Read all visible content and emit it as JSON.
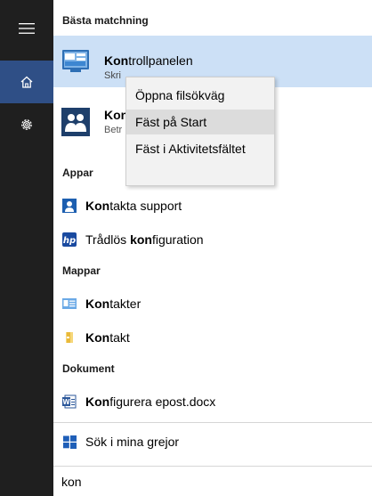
{
  "rail": {
    "menu_icon": "hamburger-icon",
    "home_icon": "home-icon",
    "settings_icon": "gear-icon",
    "accent": "#2f4f86"
  },
  "sections": {
    "best_match": "Bästa matchning",
    "apps": "Appar",
    "folders": "Mappar",
    "documents": "Dokument"
  },
  "best_match": {
    "title_bold": "Kon",
    "title_rest": "trollpanelen",
    "subtitle_visible": "Skri",
    "icon": "control-panel-icon"
  },
  "second_match": {
    "title_bold": "Kon",
    "subtitle_visible": "Betr",
    "icon": "people-icon"
  },
  "context_menu": {
    "items": [
      {
        "label": "Öppna filsökväg"
      },
      {
        "label": "Fäst på Start"
      },
      {
        "label": "Fäst i Aktivitetsfältet"
      }
    ],
    "hovered_index": 1
  },
  "apps": [
    {
      "bold": "Kon",
      "rest": "takta support",
      "icon": "contact-support-icon"
    },
    {
      "prefix": "Trådlös ",
      "bold": "kon",
      "rest": "figuration",
      "icon": "hp-wireless-icon"
    }
  ],
  "folders": [
    {
      "bold": "Kon",
      "rest": "takter",
      "icon": "contacts-folder-icon"
    },
    {
      "bold": "Kon",
      "rest": "takt",
      "icon": "folder-icon"
    }
  ],
  "documents": [
    {
      "bold": "Kon",
      "rest": "figurera epost.docx",
      "icon": "word-document-icon"
    }
  ],
  "search_my_stuff": {
    "label": "Sök i mina grejor",
    "icon": "windows-logo-icon"
  },
  "search": {
    "value": "kon"
  }
}
